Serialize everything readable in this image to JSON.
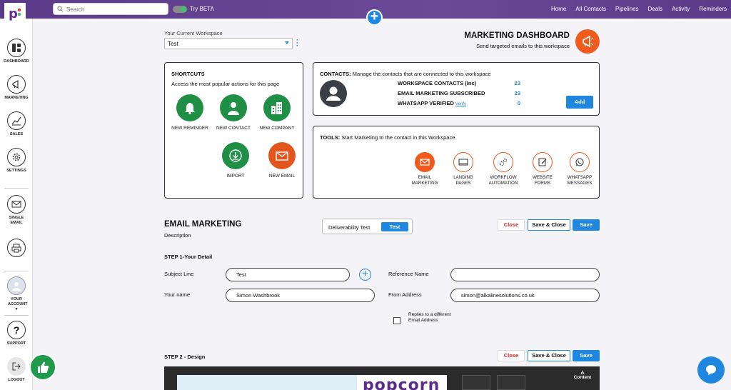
{
  "topbar": {
    "search_placeholder": "Search",
    "beta_label": "Try BETA",
    "nav": [
      "Home",
      "All Contacts",
      "Pipelines",
      "Deals",
      "Activity",
      "Reminders"
    ]
  },
  "sidebar": {
    "items": [
      {
        "label": "DASHBOARD",
        "icon": "dashboard-icon"
      },
      {
        "label": "MARKETING",
        "icon": "megaphone-icon"
      },
      {
        "label": "SALES",
        "icon": "chart-line-icon"
      },
      {
        "label": "SETTINGS",
        "icon": "gear-icon"
      },
      {
        "label": "SINGLE EMAIL",
        "icon": "envelope-icon"
      },
      {
        "label": "",
        "icon": "printer-icon"
      },
      {
        "label": "YOUR ACCOUNT",
        "icon": "avatar-icon"
      },
      {
        "label": "SUPPORT",
        "icon": "question-icon"
      },
      {
        "label": "LOGOUT",
        "icon": "logout-icon"
      }
    ]
  },
  "workspace": {
    "label": "Your Current Workspace",
    "value": "Test"
  },
  "dashboard": {
    "title": "MARKETING DASHBOARD",
    "subtitle": "Send targeted emails to this workspace"
  },
  "shortcuts": {
    "title": "SHORTCUTS",
    "subtitle": "Access the most popular actions for this page",
    "items": [
      {
        "label": "NEW REMINDER"
      },
      {
        "label": "NEW CONTACT"
      },
      {
        "label": "NEW COMPANY"
      },
      {
        "label": "IMPORT"
      },
      {
        "label": "NEW EMAIL"
      }
    ]
  },
  "contacts": {
    "title": "CONTACTS:",
    "subtitle": "Manage the contacts that are connected to this workspace",
    "rows": [
      {
        "label": "WORKSPACE CONTACTS (Inc)",
        "value": "23"
      },
      {
        "label": "EMAIL MARKETING SUBSCRIBED",
        "value": "23"
      },
      {
        "label": "WHATSAPP VERIFIED",
        "value": "0"
      }
    ],
    "verify_link": "Verify",
    "add_label": "Add"
  },
  "tools": {
    "title": "TOOLS:",
    "subtitle": "Start Marketing to the contact in this Workspace",
    "items": [
      {
        "line1": "EMAIL",
        "line2": "MARKETING"
      },
      {
        "line1": "LANDING",
        "line2": "PAGES"
      },
      {
        "line1": "WORKFLOW",
        "line2": "AUTOMATION"
      },
      {
        "line1": "WEBSITE",
        "line2": "FORMS"
      },
      {
        "line1": "WHATSAPP",
        "line2": "MESSAGES"
      }
    ]
  },
  "email_marketing": {
    "title": "EMAIL MARKETING",
    "description": "Description",
    "deliverability_label": "Deliverability Test",
    "test_label": "Test",
    "close_label": "Close",
    "save_close_label": "Save & Close",
    "save_label": "Save"
  },
  "step1": {
    "title": "STEP 1-Your Detail",
    "subject_label": "Subject Line",
    "subject_value": "Test",
    "reference_label": "Reference Name",
    "reference_value": "",
    "name_label": "Your name",
    "name_value": "Simon Washbrook",
    "from_label": "From Address",
    "from_value": "simon@alkalinesolutions.co.uk",
    "reply_label": "Replies to a different Email Address"
  },
  "step2": {
    "title": "STEP 2 - Design",
    "close_label": "Close",
    "save_close_label": "Save & Close",
    "save_label": "Save",
    "preview_brand": "popcorn",
    "content_label": "Content"
  }
}
